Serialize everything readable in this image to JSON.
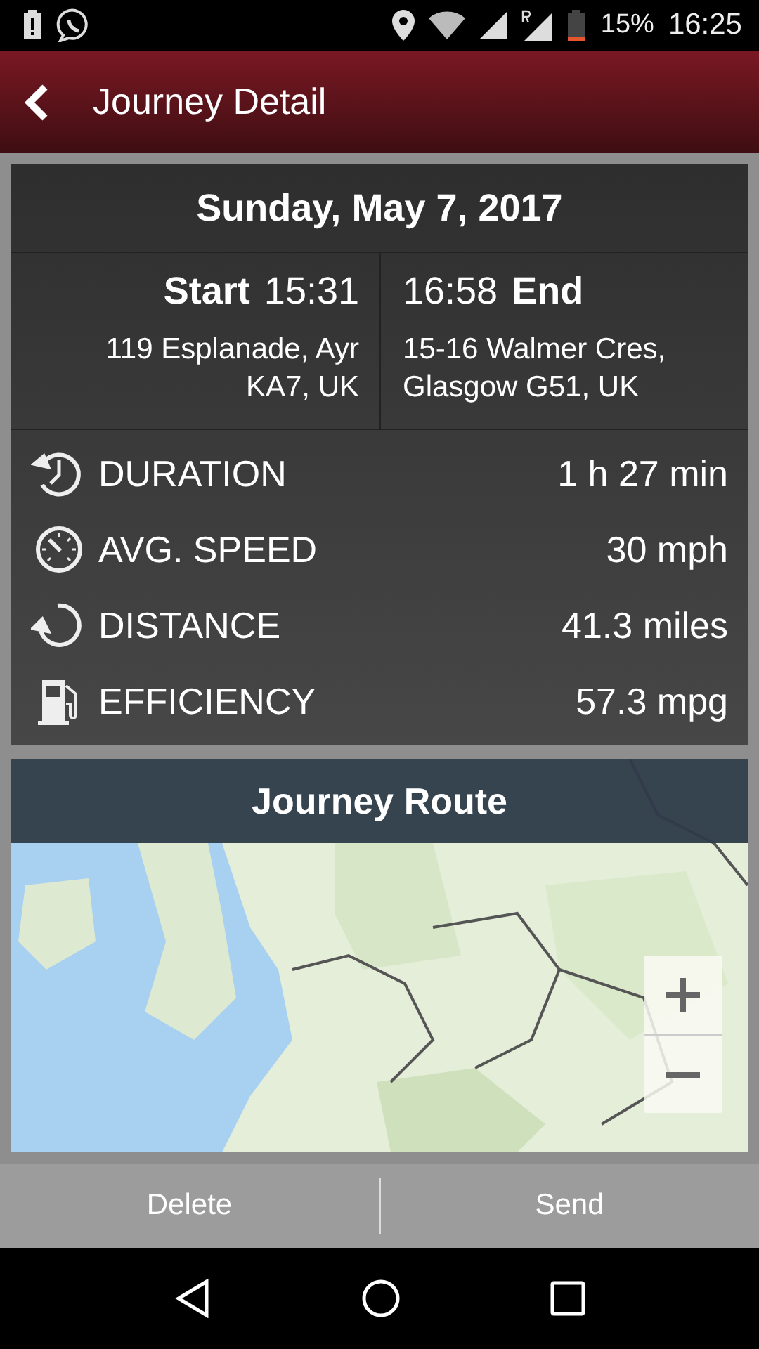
{
  "status_bar": {
    "battery": "15%",
    "time": "16:25"
  },
  "header": {
    "title": "Journey Detail"
  },
  "journey": {
    "date": "Sunday, May 7, 2017",
    "start": {
      "label": "Start",
      "time": "15:31",
      "address": "119 Esplanade, Ayr KA7, UK"
    },
    "end": {
      "label": "End",
      "time": "16:58",
      "address": "15-16 Walmer Cres, Glasgow G51, UK"
    },
    "stats": [
      {
        "kind": "duration",
        "label": "DURATION",
        "value": "1 h 27 min"
      },
      {
        "kind": "speed",
        "label": "AVG. SPEED",
        "value": "30 mph"
      },
      {
        "kind": "distance",
        "label": "DISTANCE",
        "value": "41.3 miles"
      },
      {
        "kind": "fuel",
        "label": "EFFICIENCY",
        "value": "57.3 mpg"
      }
    ]
  },
  "map": {
    "title": "Journey Route"
  },
  "actions": [
    "Delete",
    "Send"
  ]
}
